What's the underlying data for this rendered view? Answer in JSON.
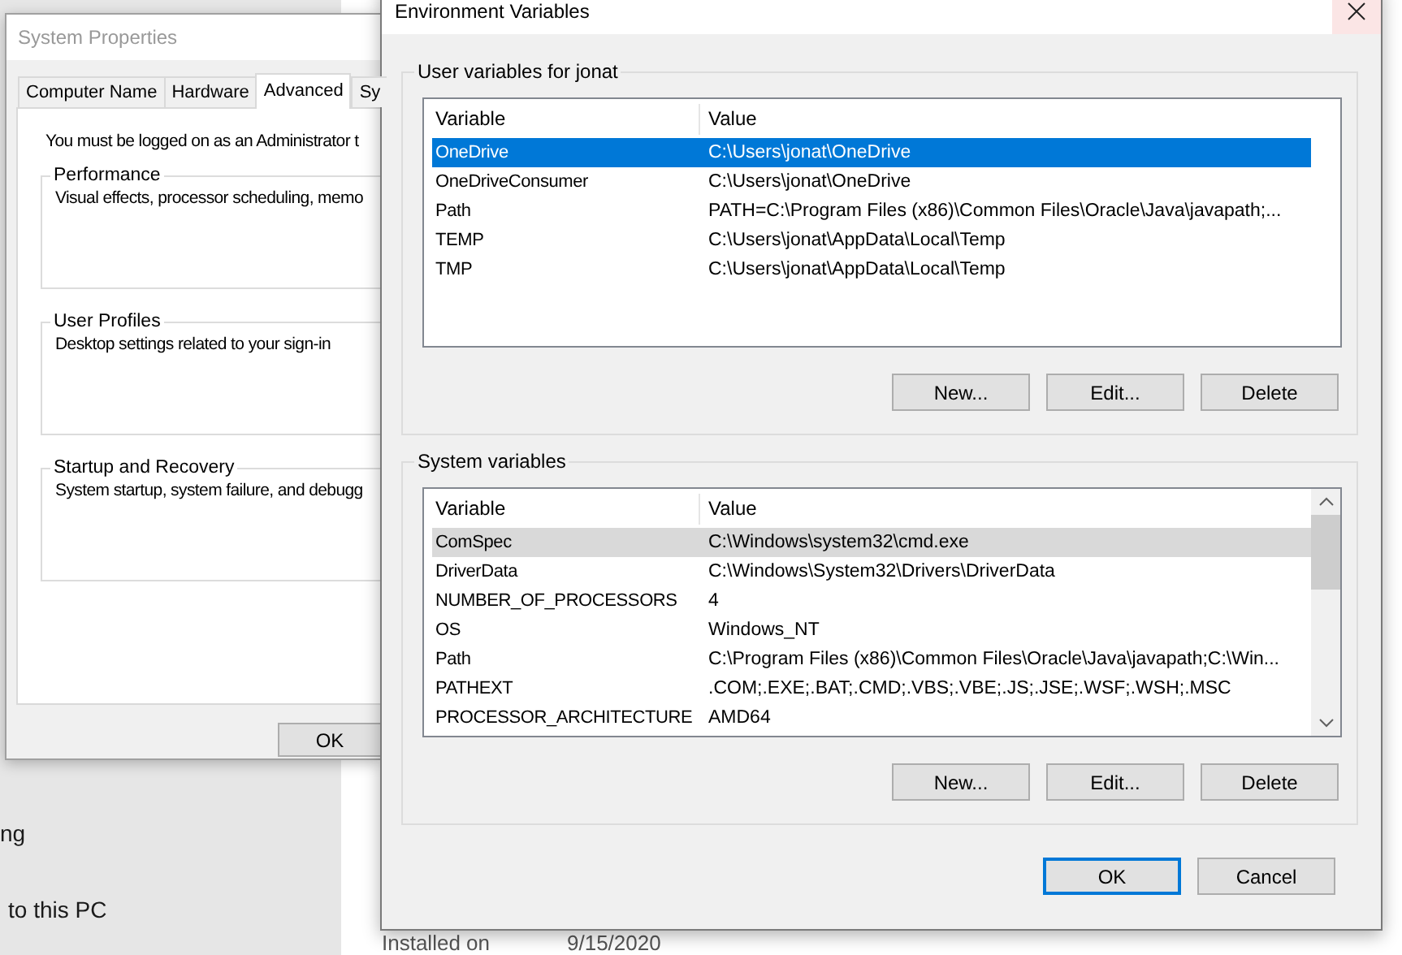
{
  "background": {
    "texts": [
      "ng",
      "to this PC"
    ],
    "installed": {
      "label": "Installed on",
      "value": "9/15/2020"
    }
  },
  "system_properties": {
    "title": "System Properties",
    "tabs": [
      {
        "label": "Computer Name",
        "selected": false
      },
      {
        "label": "Hardware",
        "selected": false
      },
      {
        "label": "Advanced",
        "selected": true
      },
      {
        "label": "Sy",
        "selected": false
      }
    ],
    "notice": "You must be logged on as an Administrator t",
    "groups": [
      {
        "title": "Performance",
        "description": "Visual effects, processor scheduling, memo"
      },
      {
        "title": "User Profiles",
        "description": "Desktop settings related to your sign-in"
      },
      {
        "title": "Startup and Recovery",
        "description": "System startup, system failure, and debugg"
      }
    ],
    "buttons": [
      "OK"
    ]
  },
  "environment_variables": {
    "title": "Environment Variables",
    "user_variables": {
      "title": "User variables for jonat",
      "focused": true,
      "scrollable": false,
      "columns": [
        "Variable",
        "Value"
      ],
      "rows": [
        {
          "variable": "OneDrive",
          "value": "C:\\Users\\jonat\\OneDrive",
          "selected": true
        },
        {
          "variable": "OneDriveConsumer",
          "value": "C:\\Users\\jonat\\OneDrive",
          "selected": false
        },
        {
          "variable": "Path",
          "value": "PATH=C:\\Program Files (x86)\\Common Files\\Oracle\\Java\\javapath;...",
          "selected": false
        },
        {
          "variable": "TEMP",
          "value": "C:\\Users\\jonat\\AppData\\Local\\Temp",
          "selected": false
        },
        {
          "variable": "TMP",
          "value": "C:\\Users\\jonat\\AppData\\Local\\Temp",
          "selected": false
        }
      ],
      "buttons": [
        "New...",
        "Edit...",
        "Delete"
      ]
    },
    "system_variables": {
      "title": "System variables",
      "focused": false,
      "scrollable": true,
      "columns": [
        "Variable",
        "Value"
      ],
      "rows": [
        {
          "variable": "ComSpec",
          "value": "C:\\Windows\\system32\\cmd.exe",
          "selected": true
        },
        {
          "variable": "DriverData",
          "value": "C:\\Windows\\System32\\Drivers\\DriverData",
          "selected": false
        },
        {
          "variable": "NUMBER_OF_PROCESSORS",
          "value": "4",
          "selected": false
        },
        {
          "variable": "OS",
          "value": "Windows_NT",
          "selected": false
        },
        {
          "variable": "Path",
          "value": "C:\\Program Files (x86)\\Common Files\\Oracle\\Java\\javapath;C:\\Win...",
          "selected": false
        },
        {
          "variable": "PATHEXT",
          "value": ".COM;.EXE;.BAT;.CMD;.VBS;.VBE;.JS;.JSE;.WSF;.WSH;.MSC",
          "selected": false
        },
        {
          "variable": "PROCESSOR_ARCHITECTURE",
          "value": "AMD64",
          "selected": false
        }
      ],
      "buttons": [
        "New...",
        "Edit...",
        "Delete"
      ]
    },
    "buttons": [
      {
        "label": "OK",
        "default": true
      },
      {
        "label": "Cancel",
        "default": false
      }
    ]
  }
}
